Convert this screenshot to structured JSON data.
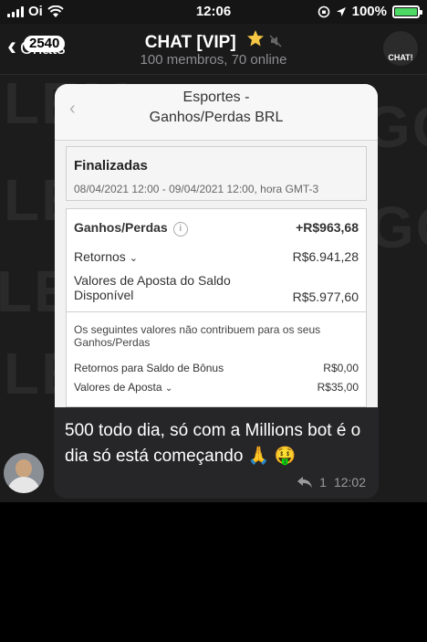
{
  "status_bar": {
    "carrier": "Oi",
    "time": "12:06",
    "battery": "100%",
    "battery_level": 1.0
  },
  "header": {
    "back_badge": "2540",
    "back_label": "Chats",
    "title": "CHAT [VIP]",
    "subtitle": "100 membros, 70 online",
    "avatar_label": "CHAT!"
  },
  "background": {
    "words": [
      "LEM",
      "LEM",
      "LE",
      "LEM",
      "GOO",
      "GOL"
    ]
  },
  "screenshot": {
    "nav_title_line1": "Esportes -",
    "nav_title_line2": "Ganhos/Perdas BRL",
    "section_title": "Finalizadas",
    "date_range": "08/04/2021 12:00 - 09/04/2021 12:00, hora GMT-3",
    "profit_label": "Ganhos/Perdas",
    "profit_value": "+R$963,68",
    "returns_label": "Retornos",
    "returns_value": "R$6.941,28",
    "stake_label_1": "Valores de Aposta do Saldo",
    "stake_label_2": "Disponível",
    "stake_value": "R$5.977,60",
    "note_1": "Os seguintes valores não contribuem para os seus",
    "note_2": "Ganhos/Perdas",
    "bonus_returns_label": "Retornos para Saldo de Bônus",
    "bonus_returns_value": "R$0,00",
    "bet_values_label": "Valores de Aposta",
    "bet_values_value": "R$35,00"
  },
  "message": {
    "text": "500 todo dia, só com a Millions bot é o dia só está começando 🙏 🤑",
    "reply_count": "1",
    "time": "12:02"
  },
  "colors": {
    "accent_green": "#4cd964",
    "bubble": "#262628",
    "header": "#1a1a1a"
  }
}
